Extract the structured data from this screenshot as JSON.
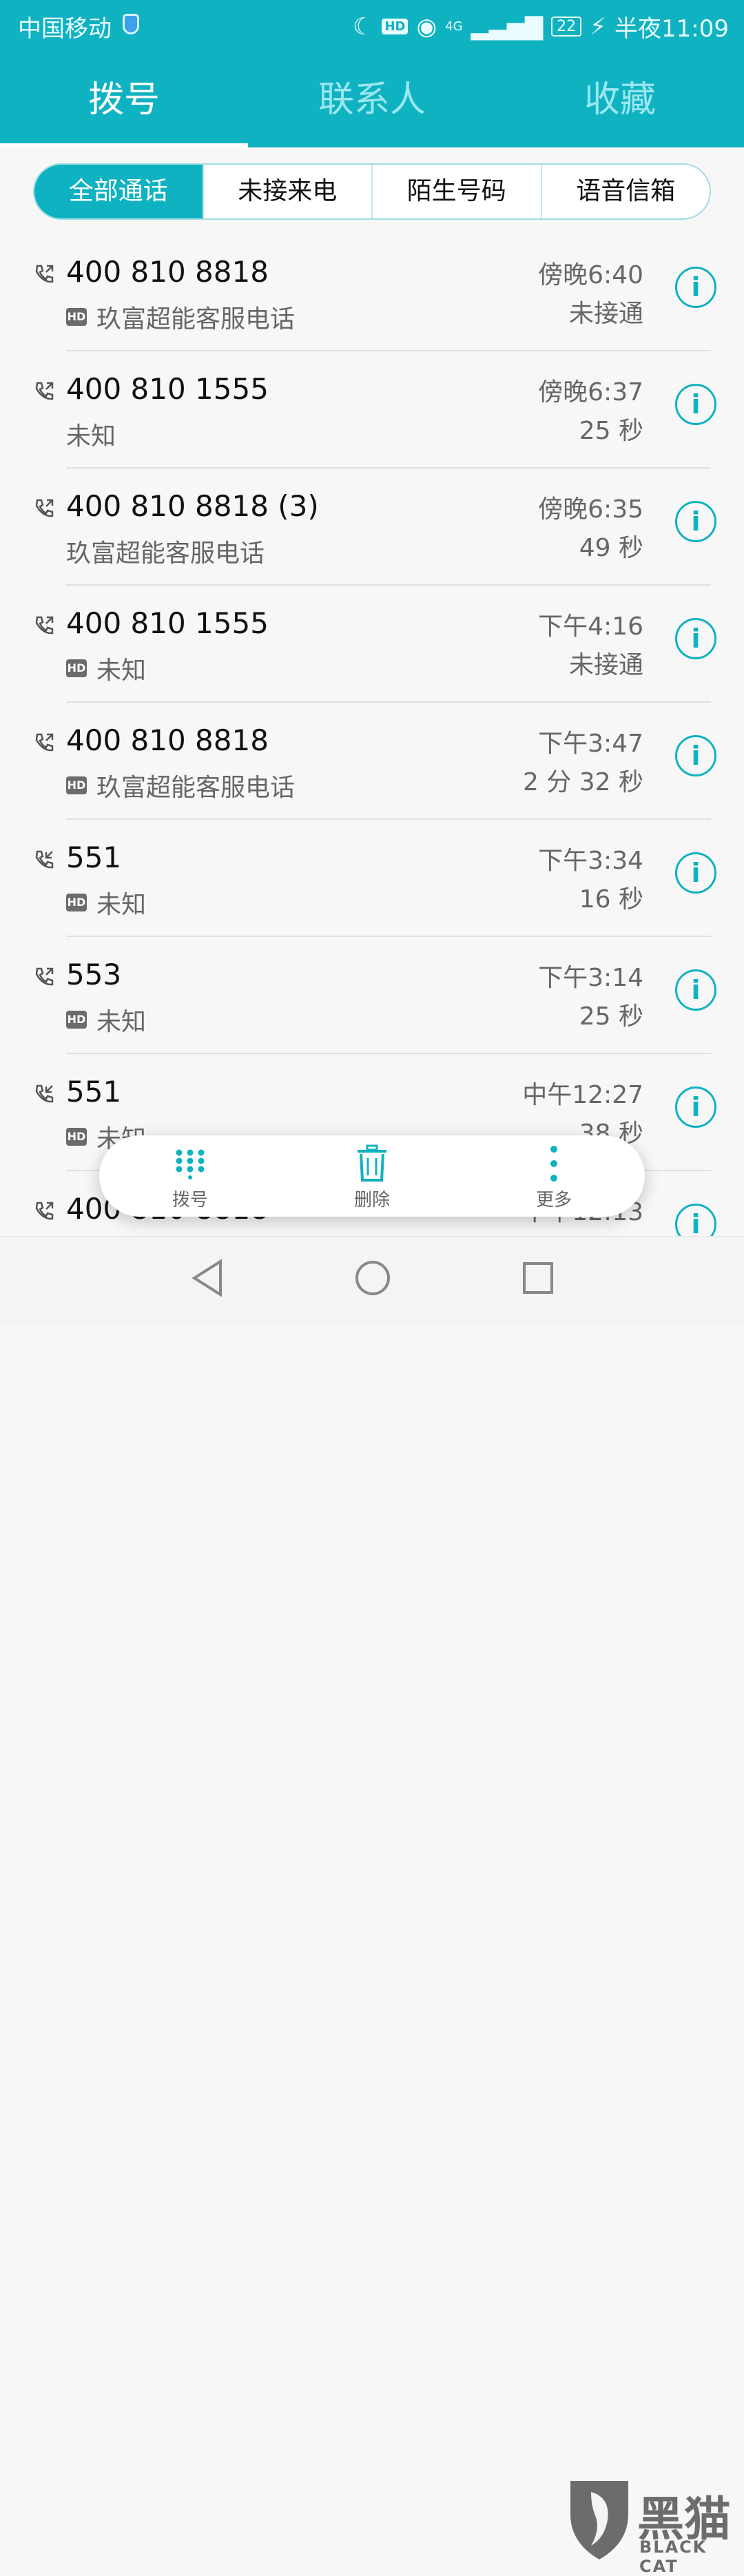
{
  "status_bar": {
    "carrier": "中国移动",
    "network": "4G",
    "battery": "22",
    "time": "半夜11:09"
  },
  "tabs": [
    {
      "label": "拨号"
    },
    {
      "label": "联系人"
    },
    {
      "label": "收藏"
    }
  ],
  "filters": [
    {
      "label": "全部通话"
    },
    {
      "label": "未接来电"
    },
    {
      "label": "陌生号码"
    },
    {
      "label": "语音信箱"
    }
  ],
  "calls": [
    {
      "number": "400 810 8818",
      "name": "玖富超能客服电话",
      "time": "傍晚6:40",
      "duration": "未接通"
    },
    {
      "number": "400 810 1555",
      "name": "未知",
      "time": "傍晚6:37",
      "duration": "25 秒"
    },
    {
      "number": "400 810 8818 (3)",
      "name": "玖富超能客服电话",
      "time": "傍晚6:35",
      "duration": "49 秒"
    },
    {
      "number": "400 810 1555",
      "name": "未知",
      "time": "下午4:16",
      "duration": "未接通"
    },
    {
      "number": "400 810 8818",
      "name": "玖富超能客服电话",
      "time": "下午3:47",
      "duration": "2 分 32 秒"
    },
    {
      "number": "551",
      "name": "未知",
      "time": "下午3:34",
      "duration": "16 秒"
    },
    {
      "number": "553",
      "name": "未知",
      "time": "下午3:14",
      "duration": "25 秒"
    },
    {
      "number": "551",
      "name": "未知",
      "time": "中午12:27",
      "duration": "38 秒"
    },
    {
      "number": "400 810 8818",
      "name": "",
      "time": "中午12:13",
      "duration": ""
    }
  ],
  "action_bar": {
    "dial": "拨号",
    "delete": "删除",
    "more": "更多"
  },
  "watermark": {
    "text": "黑猫",
    "sub": "BLACK CAT"
  },
  "colors": {
    "accent": "#0fb2c1"
  }
}
